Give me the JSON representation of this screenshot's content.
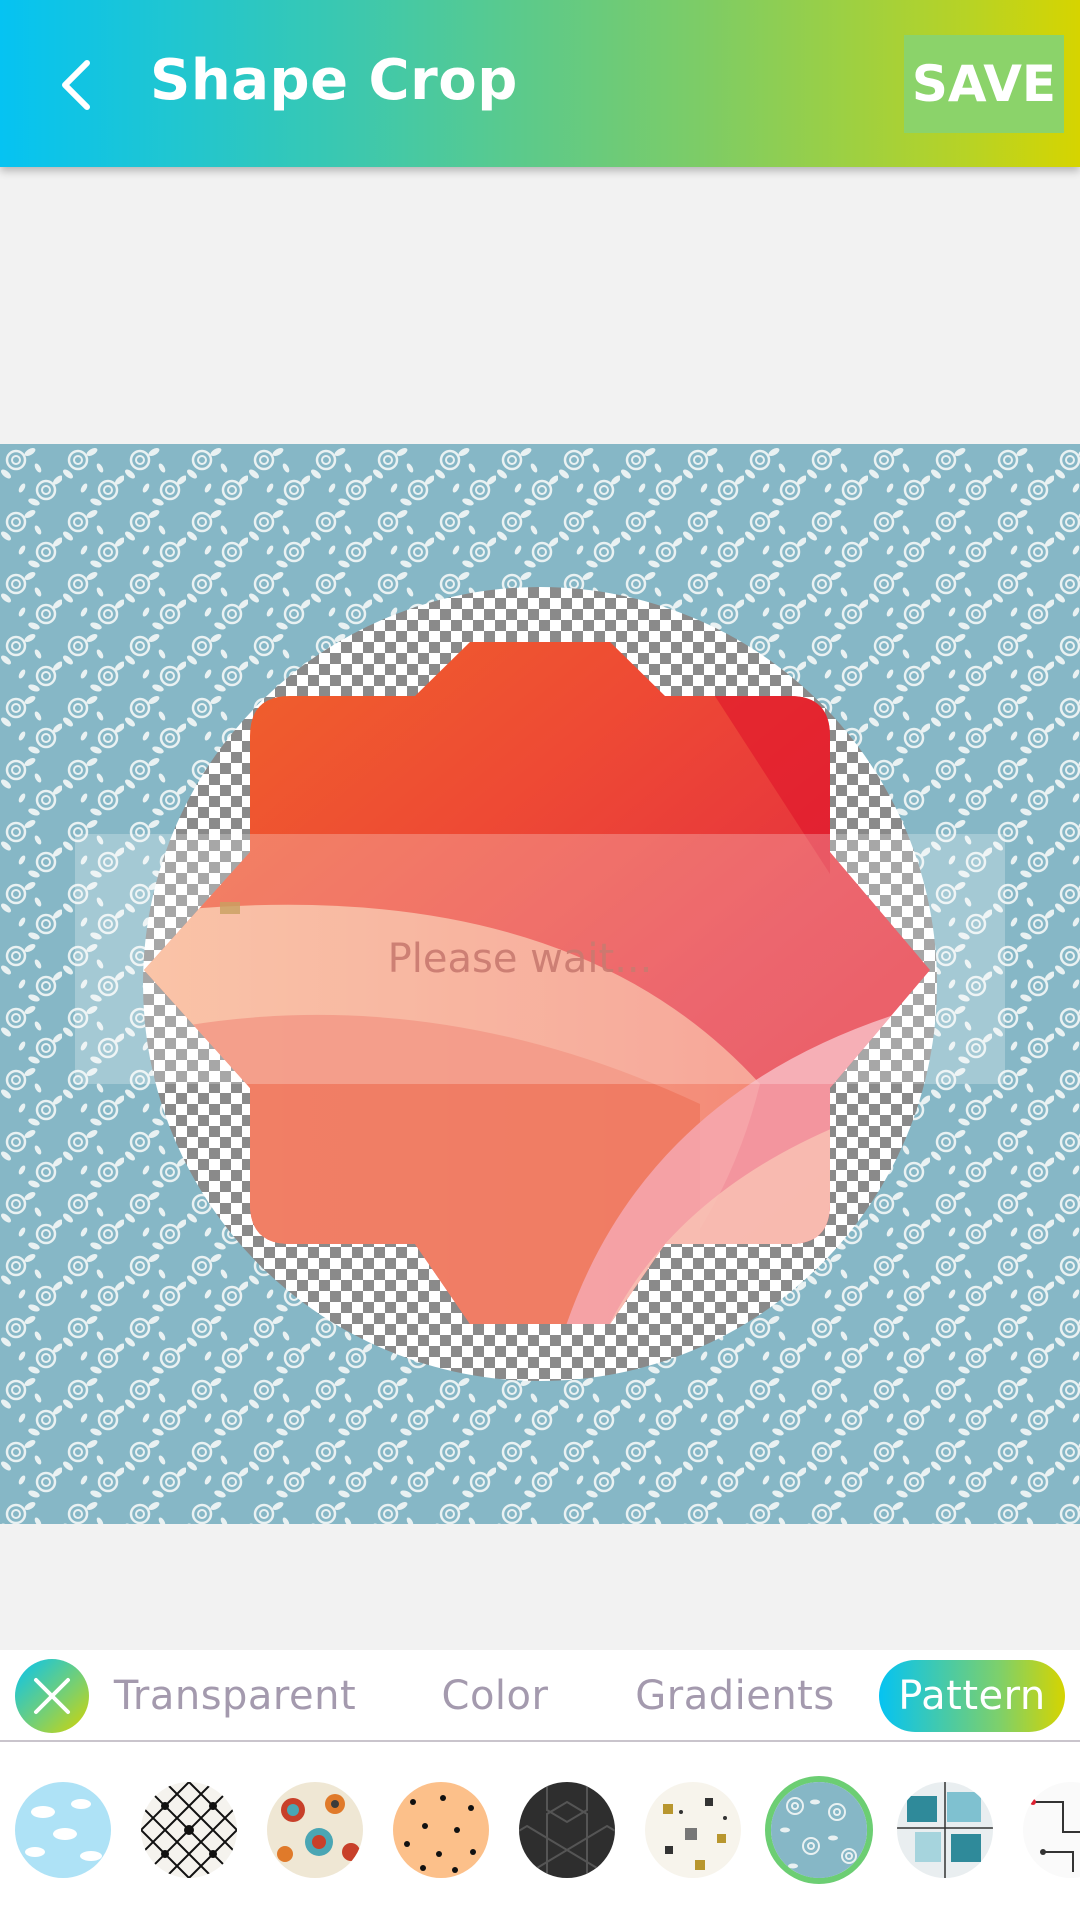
{
  "header": {
    "title": "Shape Crop",
    "save_label": "SAVE",
    "back_icon": "chevron-left-icon"
  },
  "canvas": {
    "background": "rose-pattern-blue",
    "shape": "eight-point-star",
    "loading_text": "Please wait..."
  },
  "tabs": {
    "close_icon": "close-icon",
    "items": [
      {
        "label": "Transparent",
        "active": false
      },
      {
        "label": "Color",
        "active": false
      },
      {
        "label": "Gradients",
        "active": false
      },
      {
        "label": "Pattern",
        "active": true
      }
    ]
  },
  "patterns": [
    {
      "name": "clouds-sky",
      "selected": false
    },
    {
      "name": "black-lattice",
      "selected": false
    },
    {
      "name": "retro-circles",
      "selected": false
    },
    {
      "name": "orange-dots",
      "selected": false
    },
    {
      "name": "dark-hexagons",
      "selected": false
    },
    {
      "name": "scattered-shapes",
      "selected": false
    },
    {
      "name": "rose-blue",
      "selected": true
    },
    {
      "name": "teal-squares",
      "selected": false
    },
    {
      "name": "circuit-lines",
      "selected": false
    }
  ],
  "colors": {
    "gradient_start": "#05c3f2",
    "gradient_mid": "#7ed06a",
    "gradient_end": "#d6d400",
    "pattern_bg": "#86b7c6",
    "tab_text": "#a49aae"
  }
}
